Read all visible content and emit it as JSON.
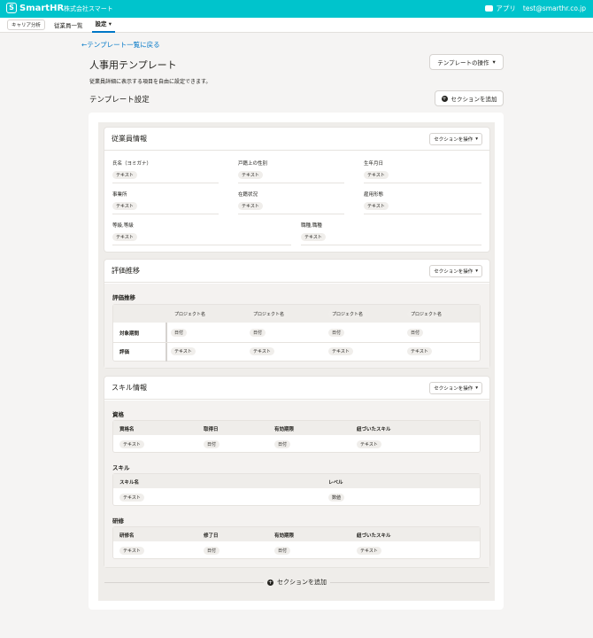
{
  "header": {
    "logo": "SmartHR",
    "company": "株式会社スマート",
    "app": "アプリ",
    "user": "test@smarthr.co.jp"
  },
  "subnav": {
    "btn": "キャリア分析",
    "items": [
      "従業員一覧",
      "設定"
    ]
  },
  "back": "テンプレート一覧に戻る",
  "title": "人事用テンプレート",
  "op_label": "テンプレートの操作",
  "description": "従業員詳細に表示する項目を自由に設定できます。",
  "template_settings": "テンプレート設定",
  "add_section": "セクションを追加",
  "section_op": "セクションを操作",
  "employee": {
    "title": "従業員情報",
    "fields": [
      {
        "label": "氏名（ヨミガナ）",
        "chip": "テキスト"
      },
      {
        "label": "戸籍上の性別",
        "chip": "テキスト"
      },
      {
        "label": "生年月日",
        "chip": "テキスト"
      },
      {
        "label": "事業所",
        "chip": "テキスト"
      },
      {
        "label": "在籍状況",
        "chip": "テキスト"
      },
      {
        "label": "雇用形態",
        "chip": "テキスト"
      },
      {
        "label": "等級,等級",
        "chip": "テキスト"
      },
      {
        "label": "職種,職種",
        "chip": "テキスト"
      }
    ]
  },
  "eval": {
    "title": "評価推移",
    "group": "評価推移",
    "cols": [
      "プロジェクト名",
      "プロジェクト名",
      "プロジェクト名",
      "プロジェクト名"
    ],
    "rows": [
      {
        "label": "対象期間",
        "cells": [
          "日付",
          "日付",
          "日付",
          "日付"
        ]
      },
      {
        "label": "評価",
        "cells": [
          "テキスト",
          "テキスト",
          "テキスト",
          "テキスト"
        ]
      }
    ]
  },
  "skill": {
    "title": "スキル情報",
    "q": {
      "title": "資格",
      "cols": [
        "資格名",
        "取得日",
        "有効期限",
        "紐づいたスキル"
      ],
      "cells": [
        "テキスト",
        "日付",
        "日付",
        "テキスト"
      ]
    },
    "s": {
      "title": "スキル",
      "cols": [
        "スキル名",
        "レベル"
      ],
      "cells": [
        "テキスト",
        "数値"
      ]
    },
    "t": {
      "title": "研修",
      "cols": [
        "研修名",
        "修了日",
        "有効期限",
        "紐づいたスキル"
      ],
      "cells": [
        "テキスト",
        "日付",
        "日付",
        "テキスト"
      ]
    }
  }
}
